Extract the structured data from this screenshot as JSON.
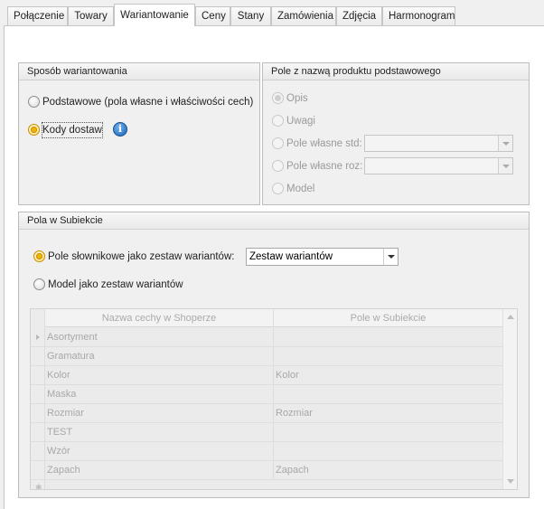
{
  "tabs": [
    {
      "label": "Połączenie",
      "active": false
    },
    {
      "label": "Towary",
      "active": false
    },
    {
      "label": "Wariantowanie",
      "active": true
    },
    {
      "label": "Ceny",
      "active": false
    },
    {
      "label": "Stany",
      "active": false
    },
    {
      "label": "Zamówienia",
      "active": false
    },
    {
      "label": "Zdjęcia",
      "active": false
    },
    {
      "label": "Harmonogram",
      "active": false
    }
  ],
  "variant_method": {
    "title": "Sposób wariantowania",
    "option_basic": "Podstawowe (pola własne i właściwości cech)",
    "option_codes": "Kody dostaw",
    "selected": "option_codes",
    "info_icon": "i"
  },
  "base_name_field": {
    "title": "Pole z nazwą produktu podstawowego",
    "options": {
      "opis": "Opis",
      "uwagi": "Uwagi",
      "custom_std": "Pole własne std:",
      "custom_roz": "Pole własne roz:",
      "model": "Model"
    },
    "selected": "opis",
    "enabled": false
  },
  "subiekt_fields": {
    "title": "Pola w Subiekcie",
    "option_dictionary": "Pole słownikowe jako zestaw wariantów:",
    "option_model": "Model jako zestaw wariantów",
    "selected": "option_dictionary",
    "dictionary_combo_value": "Zestaw wariantów",
    "grid": {
      "columns": [
        "Nazwa cechy w Shoperze",
        "Pole w Subiekcie"
      ],
      "rows": [
        [
          "Asortyment",
          ""
        ],
        [
          "Gramatura",
          ""
        ],
        [
          "Kolor",
          "Kolor"
        ],
        [
          "Maska",
          ""
        ],
        [
          "Rozmiar",
          "Rozmiar"
        ],
        [
          "TEST",
          ""
        ],
        [
          "Wzór",
          ""
        ],
        [
          "Zapach",
          "Zapach"
        ]
      ],
      "new_row_marker": "✱"
    }
  },
  "colors": {
    "radio_checked": "#f2b400",
    "info_icon": "#1d63b3",
    "disabled_text": "#9a9a9a"
  }
}
